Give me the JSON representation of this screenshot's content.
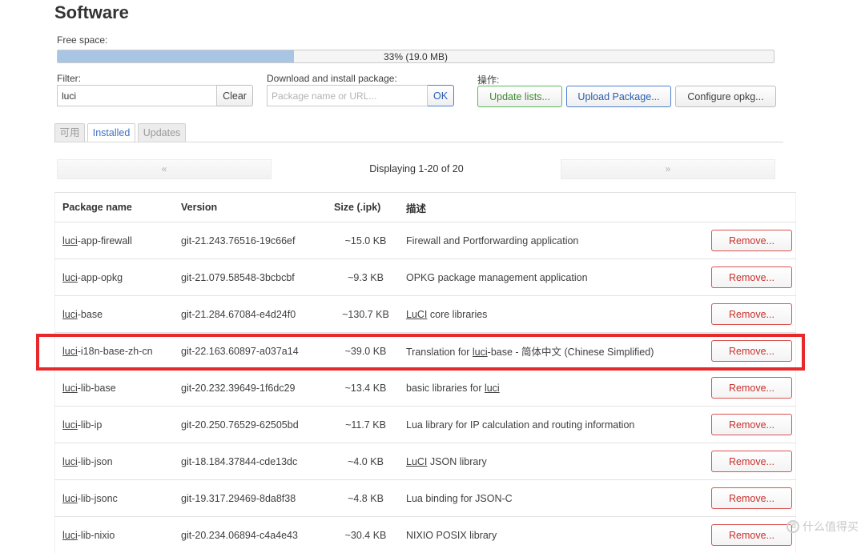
{
  "page": {
    "title": "Software"
  },
  "free_space": {
    "label": "Free space:",
    "text": "33% (19.0 MB)",
    "percent": 33,
    "fill_color": "#a8c6e4"
  },
  "filter": {
    "label": "Filter:",
    "value": "luci",
    "clear_label": "Clear"
  },
  "download": {
    "label": "Download and install package:",
    "placeholder": "Package name or URL...",
    "ok_label": "OK"
  },
  "actions": {
    "label": "操作:",
    "update_lists": "Update lists...",
    "upload_package": "Upload Package...",
    "configure_opkg": "Configure opkg..."
  },
  "tabs": [
    {
      "label": "可用",
      "active": false
    },
    {
      "label": "Installed",
      "active": true
    },
    {
      "label": "Updates",
      "active": false
    }
  ],
  "pager": {
    "prev": "«",
    "text": "Displaying 1-20 of 20",
    "next": "»"
  },
  "table": {
    "headers": {
      "name": "Package name",
      "version": "Version",
      "size": "Size (.ipk)",
      "description": "描述"
    },
    "remove_label": "Remove...",
    "rows": [
      {
        "prefix": "luci",
        "suffix": "-app-firewall",
        "version": "git-21.243.76516-19c66ef",
        "size": "~15.0 KB",
        "desc": [
          {
            "t": "Firewall and Portforwarding application",
            "u": false
          }
        ]
      },
      {
        "prefix": "luci",
        "suffix": "-app-opkg",
        "version": "git-21.079.58548-3bcbcbf",
        "size": "~9.3 KB",
        "desc": [
          {
            "t": "OPKG package management application",
            "u": false
          }
        ]
      },
      {
        "prefix": "luci",
        "suffix": "-base",
        "version": "git-21.284.67084-e4d24f0",
        "size": "~130.7 KB",
        "desc": [
          {
            "t": "LuCI",
            "u": true
          },
          {
            "t": " core libraries",
            "u": false
          }
        ]
      },
      {
        "prefix": "luci",
        "suffix": "-i18n-base-zh-cn",
        "version": "git-22.163.60897-a037a14",
        "size": "~39.0 KB",
        "desc": [
          {
            "t": "Translation for ",
            "u": false
          },
          {
            "t": "luci",
            "u": true
          },
          {
            "t": "-base - 简体中文 (Chinese Simplified)",
            "u": false
          }
        ]
      },
      {
        "prefix": "luci",
        "suffix": "-lib-base",
        "version": "git-20.232.39649-1f6dc29",
        "size": "~13.4 KB",
        "desc": [
          {
            "t": "basic libraries for ",
            "u": false
          },
          {
            "t": "luci",
            "u": true
          }
        ]
      },
      {
        "prefix": "luci",
        "suffix": "-lib-ip",
        "version": "git-20.250.76529-62505bd",
        "size": "~11.7 KB",
        "desc": [
          {
            "t": "Lua library for IP calculation and routing information",
            "u": false
          }
        ]
      },
      {
        "prefix": "luci",
        "suffix": "-lib-json",
        "version": "git-18.184.37844-cde13dc",
        "size": "~4.0 KB",
        "desc": [
          {
            "t": "LuCI",
            "u": true
          },
          {
            "t": " JSON library",
            "u": false
          }
        ]
      },
      {
        "prefix": "luci",
        "suffix": "-lib-jsonc",
        "version": "git-19.317.29469-8da8f38",
        "size": "~4.8 KB",
        "desc": [
          {
            "t": "Lua binding for JSON-C",
            "u": false
          }
        ]
      },
      {
        "prefix": "luci",
        "suffix": "-lib-nixio",
        "version": "git-20.234.06894-c4a4e43",
        "size": "~30.4 KB",
        "desc": [
          {
            "t": "NIXIO POSIX library",
            "u": false
          }
        ]
      }
    ]
  },
  "highlight_color": "#e8292b",
  "watermark": {
    "text": "什么值得买"
  }
}
